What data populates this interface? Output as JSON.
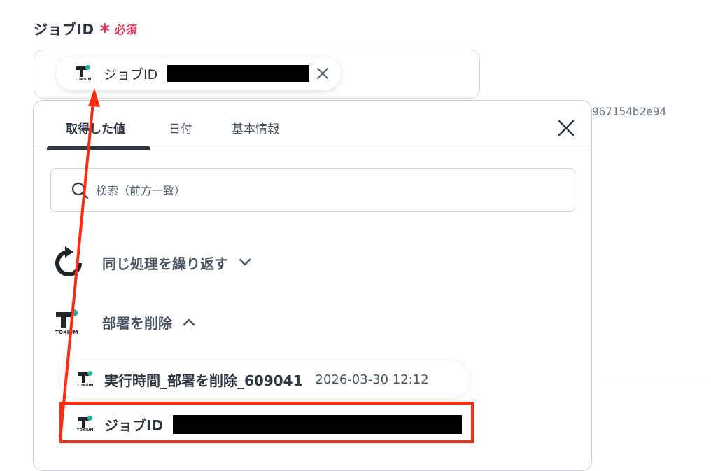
{
  "field": {
    "label": "ジョブID",
    "required_mark": "∗",
    "required_text": "必須",
    "chip_label": "ジョブID"
  },
  "background": {
    "hash_text": "967154b2e94"
  },
  "logo": {
    "word": "TOKIUM"
  },
  "panel": {
    "tabs": [
      "取得した値",
      "日付",
      "基本情報"
    ],
    "active_tab": "取得した値",
    "search_placeholder": "検索（前方一致）",
    "sections": [
      {
        "title": "同じ処理を繰り返す",
        "icon": "loop-icon",
        "expanded": false
      },
      {
        "title": "部署を削除",
        "icon": "tokium-logo",
        "expanded": true
      }
    ],
    "results": [
      {
        "label": "実行時間_部署を削除_609041",
        "value": "2026-03-30 12:12"
      },
      {
        "label": "ジョブID",
        "value": ""
      }
    ]
  },
  "colors": {
    "accent_required": "#e03b5c",
    "highlight": "#ff2a12",
    "logo_dot": "#1cb5a3"
  }
}
